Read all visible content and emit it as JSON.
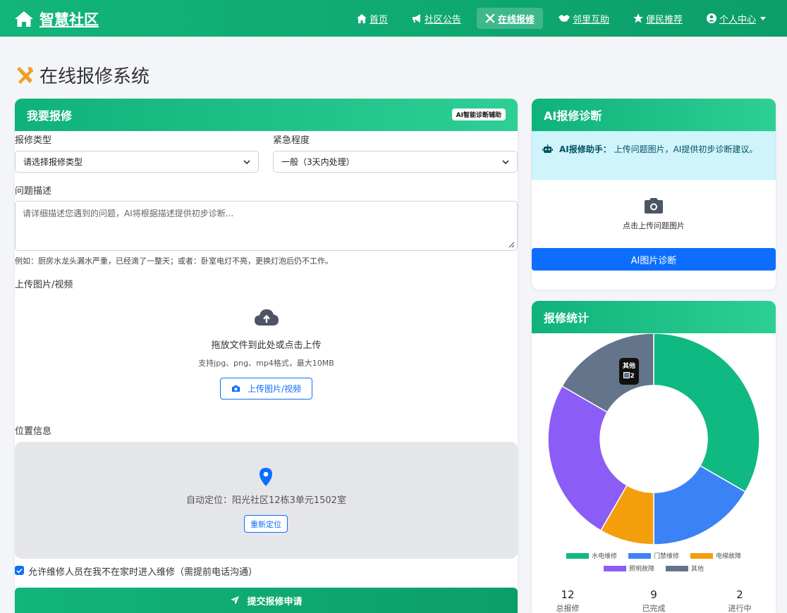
{
  "nav": {
    "brand": "智慧社区",
    "items": [
      {
        "label": "首页",
        "icon": "home-icon"
      },
      {
        "label": "社区公告",
        "icon": "megaphone-icon"
      },
      {
        "label": "在线报修",
        "icon": "tools-icon",
        "active": true
      },
      {
        "label": "邻里互助",
        "icon": "handshake-icon"
      },
      {
        "label": "便民推荐",
        "icon": "star-icon"
      },
      {
        "label": "个人中心",
        "icon": "user-circle-icon"
      }
    ]
  },
  "page": {
    "title": "在线报修系统"
  },
  "form": {
    "header": "我要报修",
    "badge": "AI智能诊断辅助",
    "type_label": "报修类型",
    "type_value": "请选择报修类型",
    "urgency_label": "紧急程度",
    "urgency_value": "一般（3天内处理）",
    "desc_label": "问题描述",
    "desc_placeholder": "请详细描述您遇到的问题，AI将根据描述提供初步诊断...",
    "desc_hint": "例如：厨房水龙头漏水严重，已经滴了一整天；或者：卧室电灯不亮，更换灯泡后仍不工作。",
    "upload_label": "上传图片/视频",
    "upload_title": "拖放文件到此处或点击上传",
    "upload_sub": "支持jpg、png、mp4格式，最大10MB",
    "upload_button": "上传图片/视频",
    "location_label": "位置信息",
    "location_text": "自动定位：阳光社区12栋3单元1502室",
    "relocate_button": "重新定位",
    "consent": "允许维修人员在我不在家时进入维修（需提前电话沟通）",
    "submit": "提交报修申请"
  },
  "ai": {
    "header": "AI报修诊断",
    "alert_title": "AI报修助手：",
    "alert_text": "上传问题图片，AI提供初步诊断建议。",
    "upload_text": "点击上传问题图片",
    "button": "AI图片诊断"
  },
  "stats": {
    "header": "报修统计",
    "tooltip_label": "其他",
    "tooltip_value": "2",
    "items": [
      {
        "value": "12",
        "label": "总报修"
      },
      {
        "value": "9",
        "label": "已完成"
      },
      {
        "value": "2",
        "label": "进行中"
      }
    ]
  },
  "chart_data": {
    "type": "pie",
    "categories": [
      "水电维修",
      "门禁维修",
      "电梯故障",
      "照明故障",
      "其他"
    ],
    "values": [
      4,
      2,
      1,
      3,
      2
    ],
    "colors": [
      "#10b981",
      "#3b82f6",
      "#f59e0b",
      "#8b5cf6",
      "#64748b"
    ],
    "legend": "bottom"
  }
}
